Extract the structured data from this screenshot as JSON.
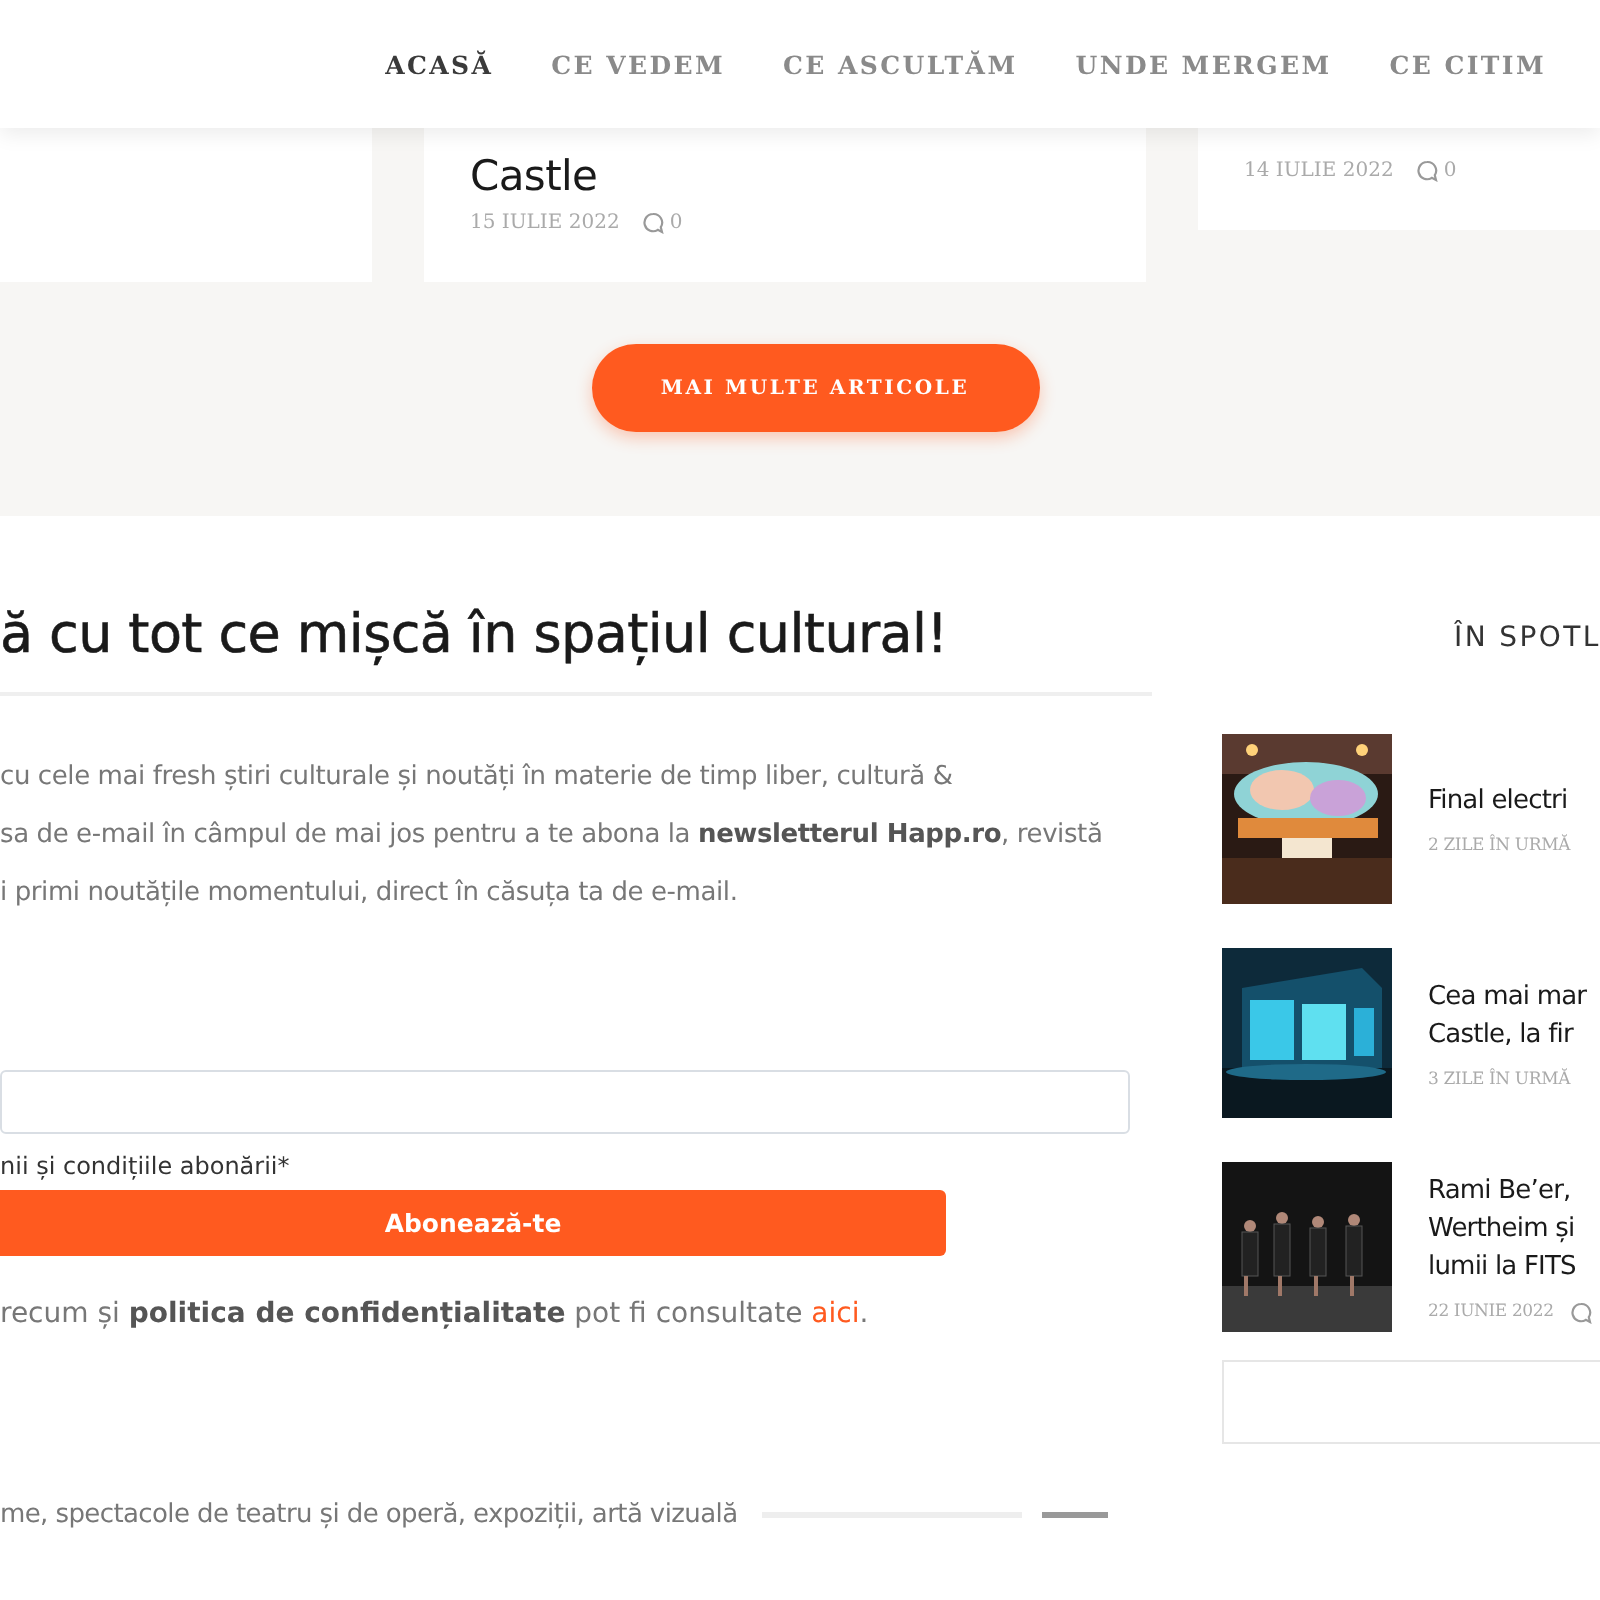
{
  "nav": {
    "items": [
      {
        "label": "ACASĂ",
        "selected": true
      },
      {
        "label": "CE VEDEM",
        "selected": false
      },
      {
        "label": "CE ASCULTĂM",
        "selected": false
      },
      {
        "label": "UNDE MERGEM",
        "selected": false
      },
      {
        "label": "CE CITIM",
        "selected": false
      }
    ]
  },
  "articles": [
    {
      "kind": "blank"
    },
    {
      "kind": "post",
      "title": "Castle",
      "date": "15 IULIE 2022",
      "comments": "0"
    },
    {
      "kind": "post",
      "date": "14 IULIE 2022",
      "comments": "0"
    }
  ],
  "more_button": "MAI MULTE ARTICOLE",
  "newsletter": {
    "heading": "ă cu tot ce mișcă în spațiul cultural!",
    "intro_lines": [
      "cu cele mai fresh știri culturale și noutăți în materie de timp liber, cultură &",
      "sa de e-mail în câmpul de mai jos pentru a te abona la **newsletterul Happ.ro**, revistă",
      "i primi noutățile momentului, direct în căsuța ta de e-mail."
    ],
    "terms_label": "nii și condițiile abonării*",
    "subscribe_button": "Abonează-te",
    "privacy_note": "recum și **politica de confidențialitate** pot fi consultate ",
    "privacy_link": "aici",
    "privacy_end": ".",
    "bottom_text": "me, spectacole de teatru și de operă, expoziții, artă vizuală"
  },
  "spotlight": {
    "heading": "ÎN SPOTL",
    "items": [
      {
        "title_lines": [
          "Final electri"
        ],
        "meta": "2 ZILE ÎN URMĂ",
        "comment_icon": false
      },
      {
        "title_lines": [
          "Cea mai mar",
          "Castle, la fir"
        ],
        "meta": "3 ZILE ÎN URMĂ",
        "comment_icon": false
      },
      {
        "title_lines": [
          "Rami Be’er,",
          "Wertheim și",
          "lumii la FITS"
        ],
        "meta": "22 IUNIE 2022",
        "comment_icon": true
      }
    ]
  }
}
